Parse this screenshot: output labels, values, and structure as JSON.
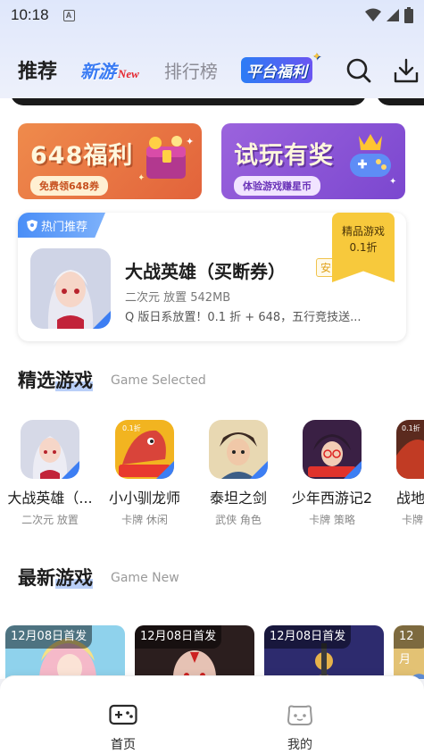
{
  "status": {
    "time": "10:18",
    "a_icon": "A"
  },
  "topnav": {
    "recommend": "推荐",
    "new_games": "新游",
    "new_badge": "New",
    "ranking": "排行榜",
    "platform_welfare": "平台福利"
  },
  "promos": [
    {
      "title": "648福利",
      "subtitle": "免费领648券"
    },
    {
      "title": "试玩有奖",
      "subtitle": "体验游戏赚星币"
    }
  ],
  "hot": {
    "tag": "热门推荐",
    "name": "大战英雄（买断券）",
    "badge": "安",
    "meta": "二次元 放置 542MB",
    "desc": "Q 版日系放置！0.1 折 + 648，五行竞技送...",
    "ribbon_line1": "精品游戏",
    "ribbon_line2": "0.1折"
  },
  "selected": {
    "title_a": "精选",
    "title_b": "游戏",
    "subtitle": "Game Selected",
    "games": [
      {
        "name": "大战英雄（...",
        "tags": "二次元 放置"
      },
      {
        "name": "小小驯龙师",
        "tags": "卡牌 休闲"
      },
      {
        "name": "泰坦之剑",
        "tags": "武侠 角色"
      },
      {
        "name": "少年西游记2",
        "tags": "卡牌 策略"
      },
      {
        "name": "战地",
        "tags": "卡牌"
      }
    ]
  },
  "newest": {
    "title_a": "最新",
    "title_b": "游戏",
    "subtitle": "Game New",
    "cards": [
      {
        "label": "12月08日首发"
      },
      {
        "label": "12月08日首发"
      },
      {
        "label": "12月08日首发"
      },
      {
        "label": "12月"
      }
    ]
  },
  "bottom_nav": {
    "home": "首页",
    "mine": "我的"
  },
  "colors": {
    "accent": "#3a7bf3",
    "active_tab": "#1e1e1e"
  }
}
